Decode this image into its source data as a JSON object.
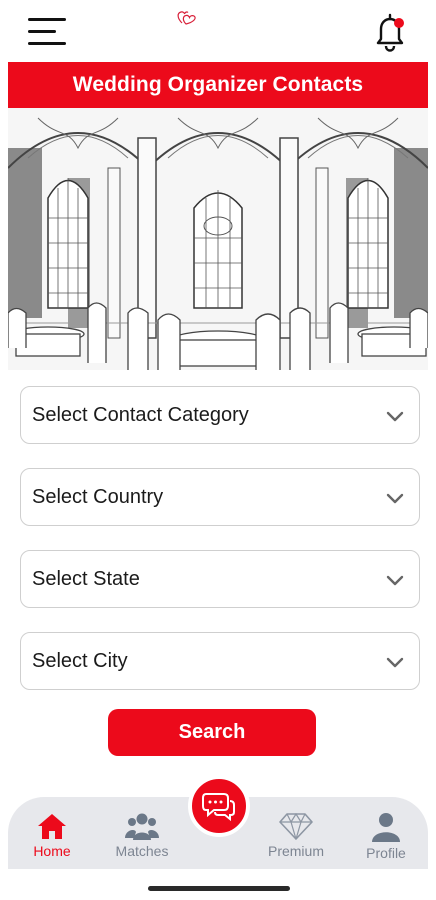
{
  "header": {
    "menu_icon": "hamburger-menu-icon",
    "logo_icon": "hearts-logo-icon",
    "notification_icon": "bell-icon",
    "notification_dot_color": "#ec0a1b"
  },
  "page": {
    "title": "Wedding Organizer Contacts",
    "accent_color": "#ec0a1b"
  },
  "form": {
    "category": {
      "label": "Select Contact Category"
    },
    "country": {
      "label": "Select Country"
    },
    "state": {
      "label": "Select State"
    },
    "city": {
      "label": "Select City"
    },
    "search_label": "Search"
  },
  "bottom_nav": {
    "items": [
      {
        "label": "Home",
        "icon": "home-icon",
        "active": true
      },
      {
        "label": "Matches",
        "icon": "matches-icon",
        "active": false
      },
      {
        "label": "Premium",
        "icon": "diamond-icon",
        "active": false
      },
      {
        "label": "Profile",
        "icon": "profile-icon",
        "active": false
      }
    ],
    "chat_icon": "chat-bubbles-icon"
  }
}
